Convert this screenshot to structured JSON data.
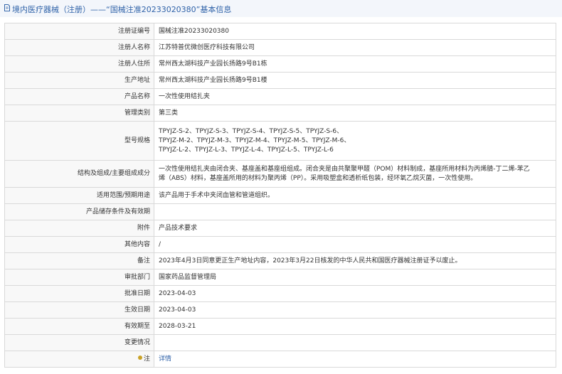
{
  "header": {
    "title": "境内医疗器械（注册）——“国械注准20233020380”基本信息"
  },
  "rows": [
    {
      "label": "注册证编号",
      "value": "国械注准20233020380"
    },
    {
      "label": "注册人名称",
      "value": "江苏特普优微创医疗科技有限公司"
    },
    {
      "label": "注册人住所",
      "value": "常州西太湖科技产业园长扬路9号B1栋"
    },
    {
      "label": "生产地址",
      "value": "常州西太湖科技产业园长扬路9号B1楼"
    },
    {
      "label": "产品名称",
      "value": "一次性使用结扎夹"
    },
    {
      "label": "管理类别",
      "value": "第三类"
    },
    {
      "label": "型号规格",
      "lines": [
        "TPYJZ-S-2、TPYJZ-S-3、TPYJZ-S-4、TPYJZ-S-5、TPYJZ-S-6、",
        "TPYJZ-M-2、TPYJZ-M-3、TPYJZ-M-4、TPYJZ-M-5、TPYJZ-M-6、",
        "TPYJZ-L-2、TPYJZ-L-3、TPYJZ-L-4、TPYJZ-L-5、TPYJZ-L-6"
      ]
    },
    {
      "label": "结构及组成/主要组成成分",
      "lines": [
        "一次性使用结扎夹由闭合夹、基座盖和基座组组成。闭合夹是由共聚聚甲醛（POM）材料制成，基座所用材料为丙烯腈-丁二烯-苯乙",
        "烯（ABS）材料，基座盖所用的材料为聚丙烯（PP）。采用吸塑盒和透析纸包装，经环氧乙烷灭菌，一次性使用。"
      ]
    },
    {
      "label": "适用范围/预期用途",
      "value": "该产品用于手术中夹闭血管和管道组织。"
    },
    {
      "label": "产品储存条件及有效期",
      "value": ""
    },
    {
      "label": "附件",
      "value": "产品技术要求"
    },
    {
      "label": "其他内容",
      "value": "/"
    },
    {
      "label": "备注",
      "value": "2023年4月3日同意更正生产地址内容，2023年3月22日核发的中华人民共和国医疗器械注册证予以废止。"
    },
    {
      "label": "审批部门",
      "value": "国家药品监督管理局"
    },
    {
      "label": "批准日期",
      "value": "2023-04-03"
    },
    {
      "label": "生效日期",
      "value": "2023-04-03"
    },
    {
      "label": "有效期至",
      "value": "2028-03-21"
    },
    {
      "label": "变更情况",
      "value": ""
    },
    {
      "label": "注",
      "value": "详情"
    }
  ]
}
